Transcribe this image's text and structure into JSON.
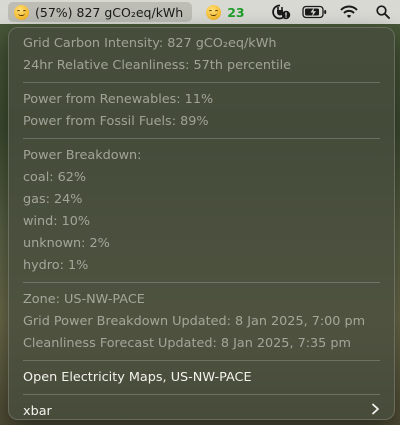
{
  "menubar": {
    "carbon_item": {
      "icon": "grinning-face-emoji",
      "label": "(57%) 827 gCO₂eq/kWh"
    },
    "score_item": {
      "icon": "grinning-face-emoji",
      "value": "23"
    },
    "status_icons": [
      "power-alert-icon",
      "battery-charging-icon",
      "wifi-icon",
      "search-icon"
    ]
  },
  "menu": {
    "summary": {
      "intensity": "Grid Carbon Intensity: 827 gCO₂eq/kWh",
      "cleanliness": "24hr Relative Cleanliness: 57th percentile"
    },
    "sources": {
      "renewables": "Power from Renewables: 11%",
      "fossil": "Power from Fossil Fuels: 89%"
    },
    "breakdown": {
      "title": "Power Breakdown:",
      "items": [
        "coal: 62%",
        "gas: 24%",
        "wind: 10%",
        "unknown: 2%",
        "hydro: 1%"
      ]
    },
    "zone_info": {
      "zone": "Zone: US-NW-PACE",
      "breakdown_updated": "Grid Power Breakdown Updated: 8 Jan 2025, 7:00 pm",
      "forecast_updated": "Cleanliness Forecast Updated: 8 Jan 2025, 7:35 pm"
    },
    "open_link": "Open Electricity Maps, US-NW-PACE",
    "xbar": {
      "label": "xbar",
      "icon": "chevron-right-icon"
    }
  }
}
